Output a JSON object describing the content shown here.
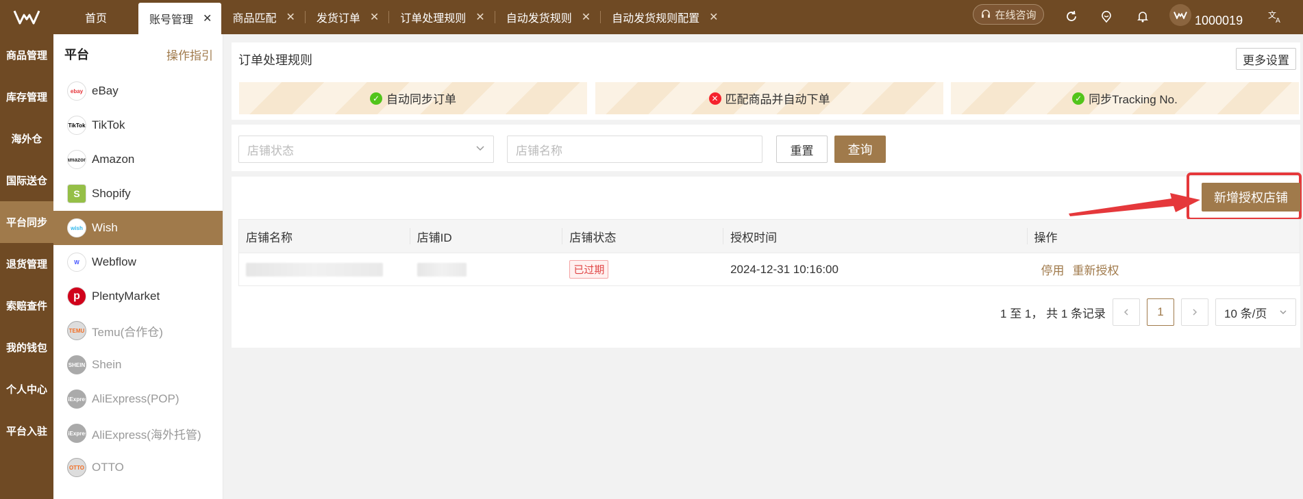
{
  "topbar": {
    "tabs": [
      {
        "label": "首页",
        "closable": false,
        "active": false
      },
      {
        "label": "账号管理",
        "closable": true,
        "active": true
      },
      {
        "label": "商品匹配",
        "closable": true,
        "active": false
      },
      {
        "label": "发货订单",
        "closable": true,
        "active": false
      },
      {
        "label": "订单处理规则",
        "closable": true,
        "active": false
      },
      {
        "label": "自动发货规则",
        "closable": true,
        "active": false
      },
      {
        "label": "自动发货规则配置",
        "closable": true,
        "active": false
      }
    ],
    "close_glyph": "✕",
    "consult_label": "在线咨询",
    "user_id": "1000019",
    "icons": [
      "refresh-icon",
      "feedback-icon",
      "bell-icon",
      "translate-icon"
    ]
  },
  "leftnav": {
    "items": [
      "商品管理",
      "库存管理",
      "海外仓",
      "国际送仓",
      "平台同步",
      "退货管理",
      "索赔查件",
      "我的钱包",
      "个人中心",
      "平台入驻"
    ],
    "active_index": 4
  },
  "platforms": {
    "title": "平台",
    "guide_label": "操作指引",
    "items": [
      {
        "label": "eBay",
        "logo_text": "ebay",
        "dim": false
      },
      {
        "label": "TikTok",
        "logo_text": "TikTok",
        "dim": false
      },
      {
        "label": "Amazon",
        "logo_text": "amazon",
        "dim": false
      },
      {
        "label": "Shopify",
        "logo_text": "S",
        "dim": false
      },
      {
        "label": "Wish",
        "logo_text": "wish",
        "dim": false
      },
      {
        "label": "Webflow",
        "logo_text": "W",
        "dim": false
      },
      {
        "label": "PlentyMarket",
        "logo_text": "p",
        "dim": false
      },
      {
        "label": "Temu(合作仓)",
        "logo_text": "TEMU",
        "dim": true
      },
      {
        "label": "Shein",
        "logo_text": "SHEIN",
        "dim": true
      },
      {
        "label": "AliExpress(POP)",
        "logo_text": "AliExpress",
        "dim": true
      },
      {
        "label": "AliExpress(海外托管)",
        "logo_text": "AliExpress",
        "dim": true
      },
      {
        "label": "OTTO",
        "logo_text": "OTTO",
        "dim": true
      }
    ],
    "active_index": 4
  },
  "rules": {
    "title": "订单处理规则",
    "more_label": "更多设置",
    "banners": [
      {
        "label": "自动同步订单",
        "status": "ok"
      },
      {
        "label": "匹配商品并自动下单",
        "status": "error"
      },
      {
        "label": "同步Tracking No.",
        "status": "ok"
      }
    ]
  },
  "filters": {
    "store_status_placeholder": "店铺状态",
    "store_name_placeholder": "店铺名称",
    "reset_label": "重置",
    "query_label": "查询"
  },
  "table": {
    "add_label": "新增授权店铺",
    "columns": [
      "店铺名称",
      "店铺ID",
      "店铺状态",
      "授权时间",
      "操作"
    ],
    "rows": [
      {
        "status": "已过期",
        "auth_time": "2024-12-31 10:16:00",
        "actions": [
          "停用",
          "重新授权"
        ]
      }
    ]
  },
  "pager": {
    "summary": "1 至 1， 共 1 条记录",
    "current_page": "1",
    "page_size": "10 条/页"
  },
  "colors": {
    "brand_dark": "#6f4a24",
    "accent": "#a07a4b",
    "highlight": "#e5383b"
  }
}
